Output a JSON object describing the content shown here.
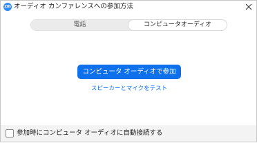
{
  "window": {
    "title": "オーディオ カンファレンスへの参加方法",
    "logo_text": "zm",
    "logo_icon": "zoom-logo-icon",
    "close_icon": "close-icon"
  },
  "tabs": [
    {
      "label": "電話",
      "selected": false
    },
    {
      "label": "コンピュータオーディオ",
      "selected": true
    }
  ],
  "main": {
    "join_button_label": "コンピュータ オーディオで参加",
    "test_link_label": "スピーカーとマイクをテスト"
  },
  "footer": {
    "auto_join_label": "参加時にコンピュータ オーディオに自動接続する",
    "auto_join_checked": false
  },
  "colors": {
    "accent": "#0e71eb",
    "logo": "#2d8cff",
    "tab_bg": "#ebebeb",
    "footer_bg": "#f3f3f3"
  }
}
